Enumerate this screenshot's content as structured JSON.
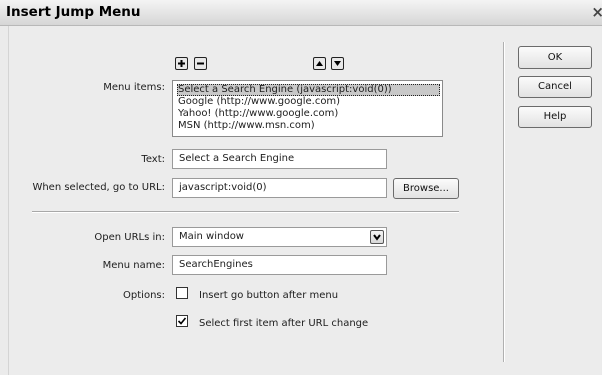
{
  "dialog": {
    "title": "Insert Jump Menu",
    "close_glyph": "×"
  },
  "toolbar": {
    "add_icon": "plus-icon",
    "remove_icon": "minus-icon",
    "move_up_icon": "triangle-up-icon",
    "move_down_icon": "triangle-down-icon"
  },
  "menu_items": {
    "label": "Menu items:",
    "items": [
      "Select a Search Engine (javascript:void(0))",
      "Google (http://www.google.com)",
      "Yahoo! (http://www.google.com)",
      "MSN (http://www.msn.com)"
    ],
    "selected_index": 0
  },
  "text_field": {
    "label": "Text:",
    "value": "Select a Search Engine"
  },
  "url_field": {
    "label": "When selected, go to URL:",
    "value": "javascript:void(0)",
    "browse_label": "Browse..."
  },
  "open_urls": {
    "label": "Open URLs in:",
    "value": "Main window"
  },
  "menu_name": {
    "label": "Menu name:",
    "value": "SearchEngines"
  },
  "options": {
    "label": "Options:",
    "insert_go_button": {
      "label": "Insert go button after menu",
      "checked": false
    },
    "select_first_item": {
      "label": "Select first item after URL change",
      "checked": true
    }
  },
  "buttons": {
    "ok": "OK",
    "cancel": "Cancel",
    "help": "Help"
  }
}
